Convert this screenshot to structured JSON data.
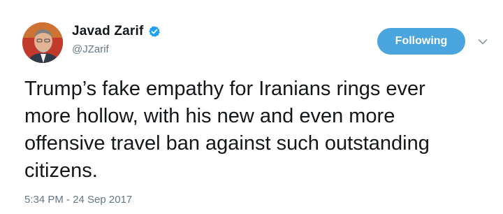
{
  "user": {
    "display_name": "Javad Zarif",
    "handle": "@JZarif",
    "verified": true,
    "avatar_icon": "profile-photo"
  },
  "follow_button": {
    "label": "Following",
    "color": "#4aa4dd"
  },
  "menu": {
    "caret_icon": "chevron-down-icon"
  },
  "tweet": {
    "text": "Trump’s fake empathy for Iranians rings ever\nmore hollow, with his new and even more\noffensive travel ban against such outstanding\ncitizens.",
    "timestamp": "5:34 PM - 24 Sep 2017"
  },
  "colors": {
    "verified_badge": "#1da1f2",
    "secondary_text": "#657786",
    "primary_text": "#14171a"
  }
}
